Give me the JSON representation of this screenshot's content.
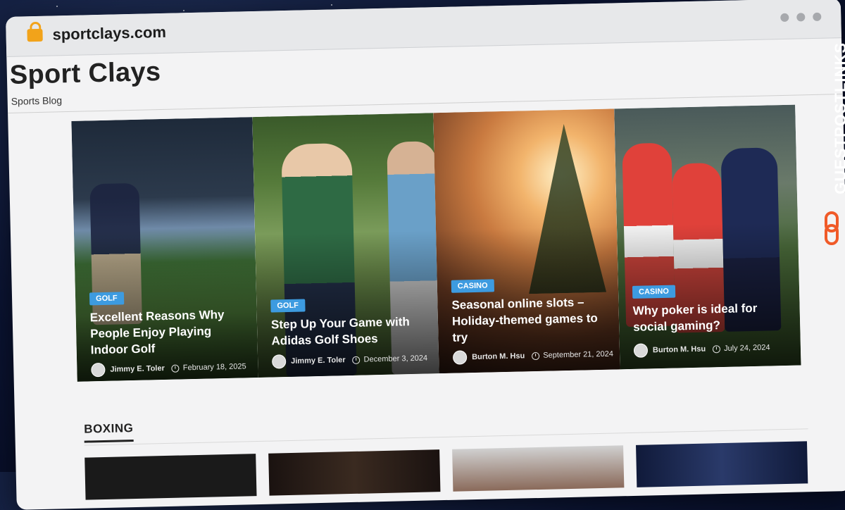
{
  "browser": {
    "url": "sportclays.com"
  },
  "site": {
    "title": "Sport Clays",
    "tagline": "Sports Blog"
  },
  "featured": [
    {
      "category": "GOLF",
      "title": "Excellent Reasons Why People Enjoy Playing Indoor Golf",
      "author": "Jimmy E. Toler",
      "date": "February 18, 2025"
    },
    {
      "category": "GOLF",
      "title": "Step Up Your Game with Adidas Golf Shoes",
      "author": "Jimmy E. Toler",
      "date": "December 3, 2024"
    },
    {
      "category": "CASINO",
      "title": "Seasonal online slots – Holiday-themed games to try",
      "author": "Burton M. Hsu",
      "date": "September 21, 2024"
    },
    {
      "category": "CASINO",
      "title": "Why poker is ideal for social gaming?",
      "author": "Burton M. Hsu",
      "date": "July 24, 2024"
    }
  ],
  "section": {
    "heading": "BOXING"
  },
  "watermark": {
    "text": "GUESTPOSTLINKS",
    "icon": "chain-link-icon",
    "accent": "#f05a28"
  },
  "colors": {
    "category_badge": "#3d9be0",
    "lock": "#f2a31a"
  }
}
